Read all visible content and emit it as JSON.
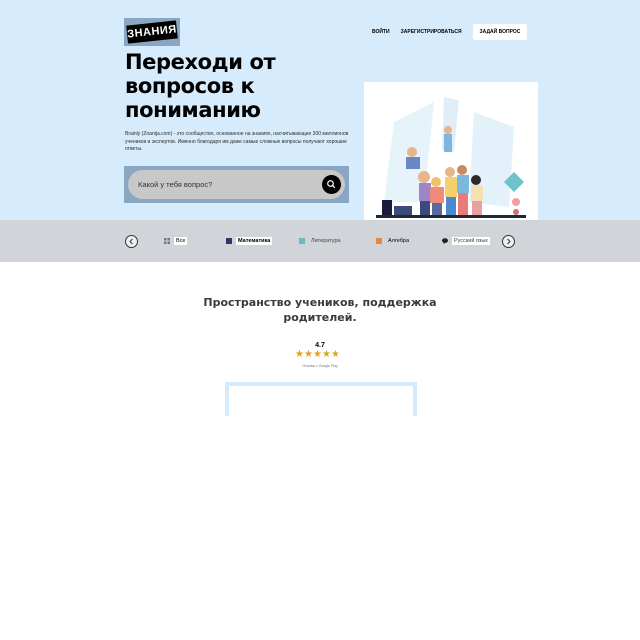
{
  "header": {
    "logo_text": "ЗНАНИЯ",
    "nav": {
      "login": "ВОЙТИ",
      "register": "ЗАРЕГИСТРИРОВАТЬСЯ",
      "ask": "ЗАДАЙ ВОПРОС"
    }
  },
  "hero": {
    "headline": "Переходи от вопросов к пониманию",
    "description": "Brainly (Znanija.com) - это сообщество, основанное на знаниях, насчитывающее 300 миллионов учеников и экспертов. Именно благодаря им даже самые сложные вопросы получают хорошие ответы.",
    "search": {
      "placeholder": "Какой у тебя вопрос?"
    }
  },
  "subjects": {
    "items": [
      {
        "label": "Все",
        "icon": "grid-icon",
        "color": "#6a7a8a"
      },
      {
        "label": "Математика",
        "icon": "math-icon",
        "color": "#2b3a67"
      },
      {
        "label": "Литература",
        "icon": "book-icon",
        "color": "#6fb6c9"
      },
      {
        "label": "Алгебра",
        "icon": "algebra-icon",
        "color": "#e8893a"
      },
      {
        "label": "Русский язык",
        "icon": "speech-icon",
        "color": "#222222"
      }
    ]
  },
  "community": {
    "title": "Пространство учеников, поддержка родителей.",
    "rating": {
      "value": "4.7",
      "stars": 4.7,
      "source": "Отзывы с Google Play"
    }
  },
  "colors": {
    "hero_bg": "#d6ecfd",
    "logo_bg": "#89a7c2",
    "strip_bg": "#d1d5d9",
    "star": "#e2a21b"
  }
}
